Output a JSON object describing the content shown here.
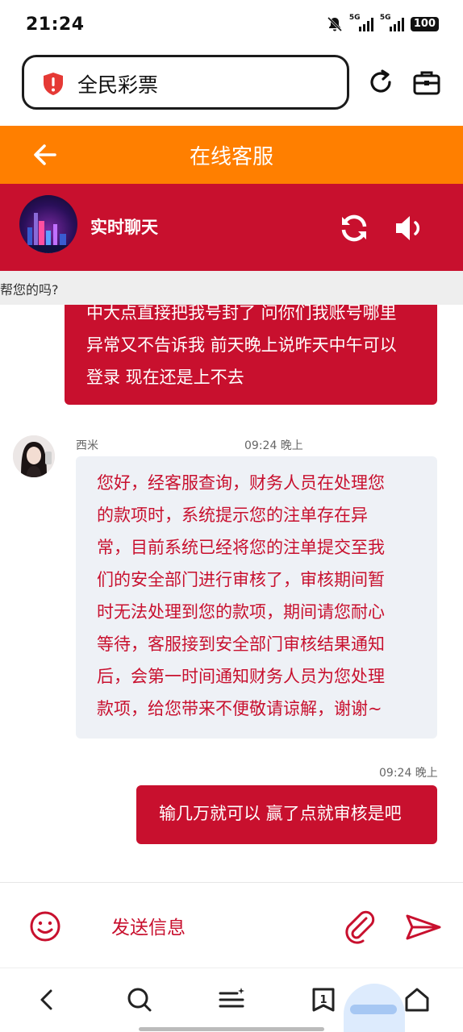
{
  "status_bar": {
    "time": "21:24",
    "net1": "5G",
    "net2": "5G",
    "battery": "100"
  },
  "browser": {
    "page_title": "全民彩票"
  },
  "header": {
    "back_icon": "arrow-left-icon",
    "title": "在线客服"
  },
  "chat_header": {
    "title": "实时聊天",
    "refresh_icon": "sync-icon",
    "sound_icon": "speaker-icon"
  },
  "notice": {
    "text": "帮您的吗?"
  },
  "messages": {
    "m1": {
      "line1": "中大点直接把我号封了 问你们我账号哪里",
      "line2": "异常又不告诉我 前天晚上说昨天中午可以",
      "line3": "登录 现在还是上不去"
    },
    "m2": {
      "sender": "西米",
      "time": "09:24 晚上",
      "lines": [
        "您好，经客服查询，财务人员在处理您",
        "的款项时，系统提示您的注单存在异",
        "常，目前系统已经将您的注单提交至我",
        "们的安全部门进行审核了，审核期间暂",
        "时无法处理到您的款项，期间请您耐心",
        "等待，客服接到安全部门审核结果通知",
        "后，会第一时间通知财务人员为您处理",
        "款项，给您带来不便敬请谅解，谢谢~"
      ]
    },
    "m3": {
      "time": "09:24 晚上",
      "text": "输几万就可以 赢了点就审核是吧"
    }
  },
  "input_bar": {
    "placeholder": "发送信息",
    "emoji_icon": "smile-icon",
    "attach_icon": "paperclip-icon",
    "send_icon": "send-icon"
  },
  "browser_nav": {
    "tab_count": "1"
  },
  "colors": {
    "orange": "#ff7f00",
    "red": "#c8102e",
    "bubble_in_bg": "#eef1f6"
  }
}
